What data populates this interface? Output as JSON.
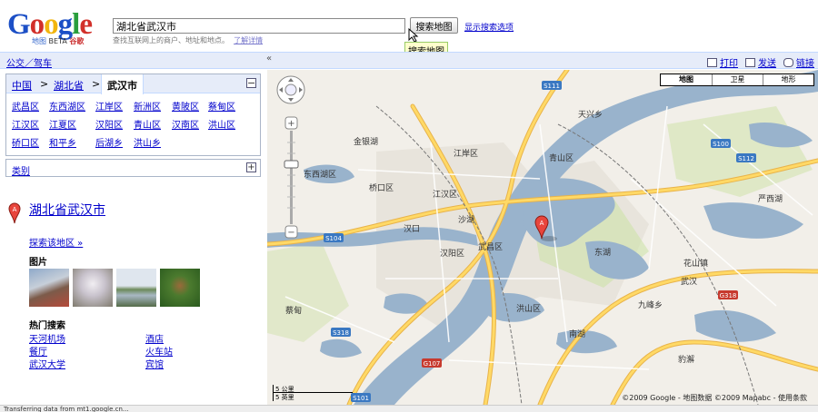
{
  "logo": {
    "word": "Google",
    "sub_maps": "地图",
    "sub_beta": "BETA",
    "sub_guge": "谷歌"
  },
  "search": {
    "value": "湖北省武汉市",
    "button_label": "搜索地图",
    "options_link": "显示搜索选项",
    "hint": "查找互联网上的商户、地址和地点。",
    "hint_link": "了解详情",
    "tooltip": "搜索地图"
  },
  "navbar": {
    "transit_link": "公交／驾车",
    "collapse": "«",
    "print": "打印",
    "send": "发送",
    "link": "链接"
  },
  "location": {
    "crumbs": [
      "中国",
      "湖北省",
      "武汉市"
    ],
    "districts": [
      "武昌区",
      "东西湖区",
      "江岸区",
      "新洲区",
      "黄陂区",
      "蔡甸区",
      "江汉区",
      "江夏区",
      "汉阳区",
      "青山区",
      "汉南区",
      "洪山区",
      "硚口区",
      "和平乡",
      "后湖乡",
      "洪山乡"
    ],
    "collapse_btn": "−"
  },
  "category": {
    "label": "类别",
    "expand_btn": "+"
  },
  "result": {
    "title": "湖北省武汉市",
    "explore": "探索该地区 »",
    "photos_label": "图片",
    "hot_label": "热门搜索",
    "hot": [
      "天河机场",
      "酒店",
      "餐厅",
      "火车站",
      "武汉大学",
      "宾馆"
    ]
  },
  "map": {
    "types": [
      "地图",
      "卫星",
      "地形"
    ],
    "copyright": "©2009 Google - 地图数据 ©2009 Mapabc - 使用条款",
    "scale_km": "5 公里",
    "scale_mi": "5 英里",
    "labels": [
      "东西湖区",
      "江岸区",
      "桥口区",
      "江汉区",
      "汉阳区",
      "武昌区",
      "青山区",
      "洪山区",
      "金银湖",
      "天兴乡",
      "花山镇",
      "九峰乡",
      "豹澥",
      "东湖",
      "严西湖",
      "蔡甸",
      "武汉",
      "沙湖",
      "南湖",
      "汉口"
    ],
    "roads": [
      "S111",
      "S101",
      "S100",
      "S112",
      "S104",
      "S318",
      "G318",
      "G107"
    ],
    "colors": {
      "water": "#99b3cc",
      "land": "#f2efe9",
      "park": "#cbe1a4",
      "road": "#ffd966",
      "road_edge": "#e8b34a",
      "urban": "#e8e4dc"
    }
  },
  "status": "Transferring data from mt1.google.cn..."
}
